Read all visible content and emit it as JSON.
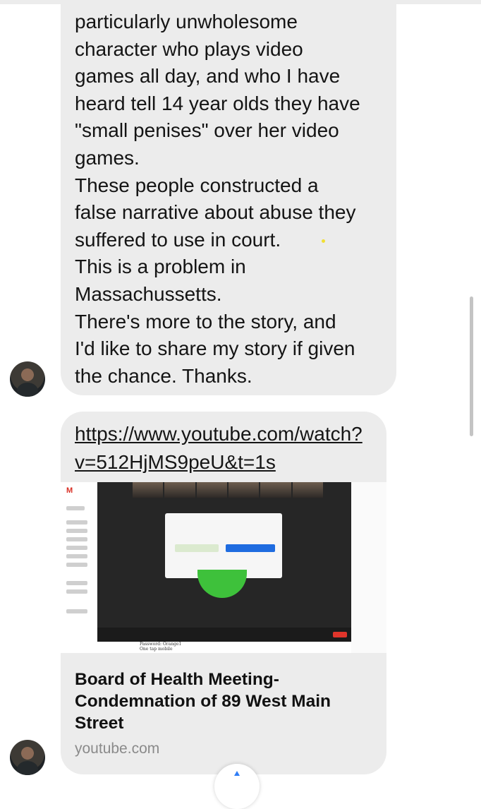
{
  "message": {
    "text": "particularly unwholesome\ncharacter who plays video\ngames all day, and who I have\nheard tell 14 year olds they have\n\"small penises\" over her video\ngames.\nThese people constructed a\nfalse narrative about abuse they\nsuffered to use in court.\nThis is a problem in\nMassachussetts.\nThere's more to the story, and\nI'd like to share my story if given\nthe chance. Thanks."
  },
  "link_card": {
    "url": "https://www.youtube.com/watch?v=512HjMS9peU&t=1s",
    "title": "Board of Health Meeting-\nCondemnation of 89 West Main\nStreet",
    "domain": "youtube.com"
  },
  "preview": {
    "gmail_label": "M",
    "paper_line_1": "Password: Orange1",
    "paper_line_2": "One tap mobile"
  },
  "colors": {
    "bubble": "#ececec",
    "link_blue": "#2f7df6"
  },
  "icons": [
    "avatar",
    "upload-icon"
  ]
}
